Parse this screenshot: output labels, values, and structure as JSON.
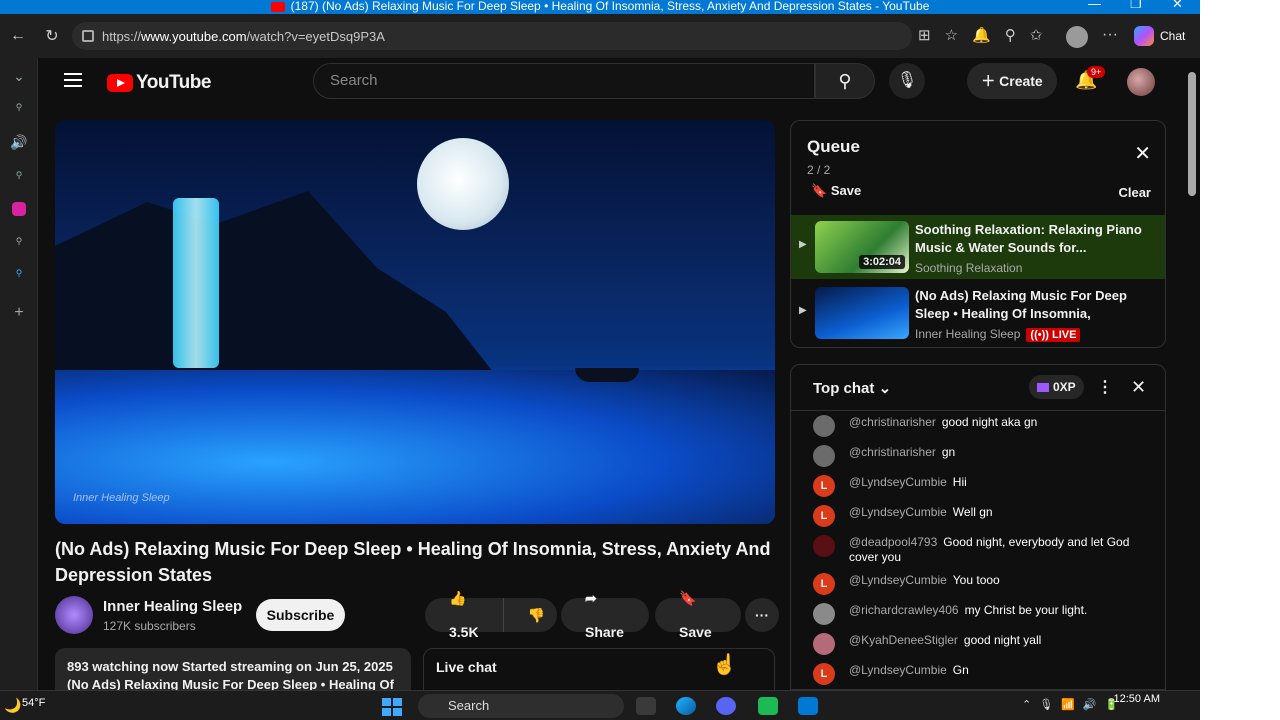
{
  "window": {
    "title": "(187) (No Ads) Relaxing Music For Deep Sleep • Healing Of Insomnia, Stress, Anxiety And Depression States - YouTube"
  },
  "browser": {
    "url_prefix": "https://",
    "url_host": "www.youtube.com",
    "url_path": "/watch?v=eyetDsq9P3A",
    "chat_label": "Chat"
  },
  "youtube": {
    "logo_text": "YouTube",
    "search_placeholder": "Search",
    "create_label": "Create",
    "notifications_badge": "9+"
  },
  "video": {
    "watermark": "Inner Healing Sleep",
    "title": "(No Ads) Relaxing Music For Deep Sleep • Healing Of Insomnia, Stress, Anxiety And Depression States",
    "channel_name": "Inner Healing Sleep",
    "channel_subs": "127K subscribers",
    "subscribe_label": "Subscribe",
    "likes": "3.5K",
    "share_label": "Share",
    "save_label": "Save",
    "desc_line1": "893 watching now  Started streaming on Jun 25, 2025",
    "desc_line2": "(No Ads) Relaxing Music For Deep Sleep • Healing Of",
    "live_chat_label": "Live chat"
  },
  "queue": {
    "title": "Queue",
    "count": "2 / 2",
    "save_label": "Save",
    "clear_label": "Clear",
    "items": [
      {
        "title": "Soothing Relaxation: Relaxing Piano Music & Water Sounds for...",
        "channel": "Soothing Relaxation",
        "duration": "3:02:04"
      },
      {
        "title": "(No Ads) Relaxing Music For Deep Sleep • Healing Of Insomnia, Stress,...",
        "channel": "Inner Healing Sleep",
        "live": "LIVE"
      }
    ]
  },
  "chat": {
    "mode": "Top chat",
    "xp": "0XP",
    "messages": [
      {
        "user": "@christinarisher",
        "text": "good night aka gn",
        "initial": "",
        "color": "#6b6b6b"
      },
      {
        "user": "@christinarisher",
        "text": "gn",
        "initial": "",
        "color": "#6b6b6b"
      },
      {
        "user": "@LyndseyCumbie",
        "text": "Hii",
        "initial": "L",
        "color": "#d93b1b"
      },
      {
        "user": "@LyndseyCumbie",
        "text": "Well gn",
        "initial": "L",
        "color": "#d93b1b"
      },
      {
        "user": "@deadpool4793",
        "text": "Good night, everybody and let God cover you",
        "initial": "",
        "color": "#5a0f14"
      },
      {
        "user": "@LyndseyCumbie",
        "text": "You tooo",
        "initial": "L",
        "color": "#d93b1b"
      },
      {
        "user": "@richardcrawley406",
        "text": "my Christ be your light.",
        "initial": "",
        "color": "#8a8a8a"
      },
      {
        "user": "@KyahDeneeStigler",
        "text": "good night yall",
        "initial": "",
        "color": "#b46a7a"
      },
      {
        "user": "@LyndseyCumbie",
        "text": "Gn",
        "initial": "L",
        "color": "#d93b1b"
      }
    ]
  },
  "taskbar": {
    "temperature": "54°F",
    "search_label": "Search",
    "time": "12:50 AM"
  }
}
